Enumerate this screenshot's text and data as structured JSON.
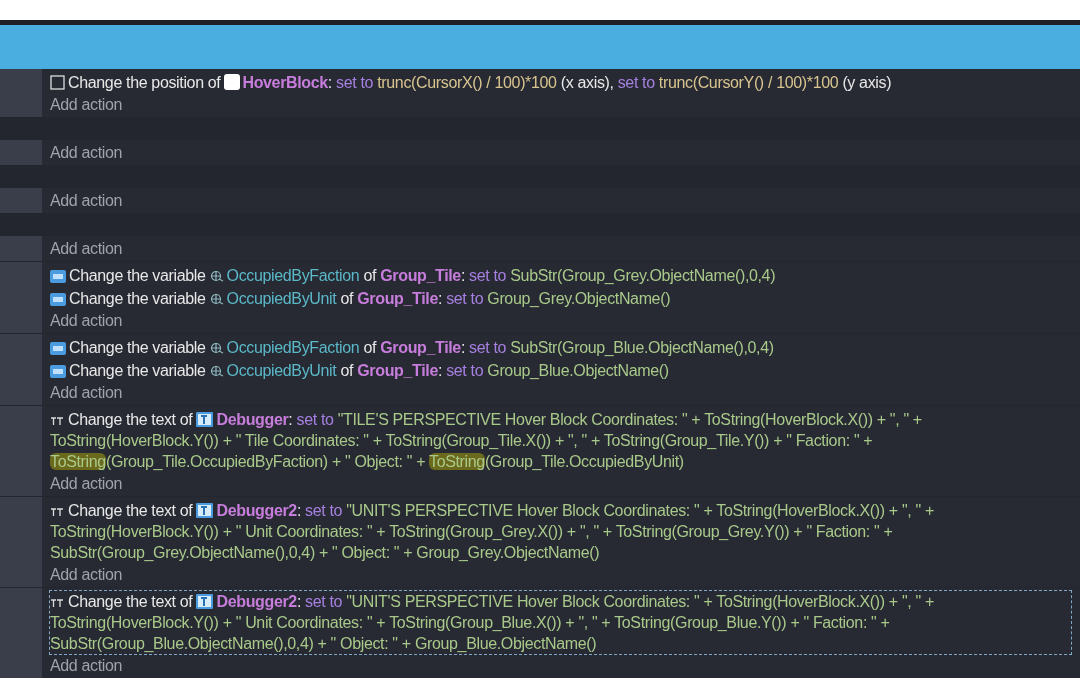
{
  "blocks": [
    {
      "actions": [
        {
          "kind": "position",
          "selected": false,
          "segments": [
            {
              "kind": "text",
              "text": "Change the position of"
            },
            {
              "kind": "object",
              "text": "HoverBlock"
            },
            {
              "kind": "text",
              "text": ": "
            },
            {
              "kind": "keyword",
              "text": "set to"
            },
            {
              "kind": "expression",
              "text": "trunc(CursorX() / 100)*100"
            },
            {
              "kind": "text",
              "text": "(x axis), "
            },
            {
              "kind": "keyword",
              "text": "set to"
            },
            {
              "kind": "expression",
              "text": "trunc(CursorY() / 100)*100"
            },
            {
              "kind": "text",
              "text": "(y axis)"
            }
          ]
        }
      ],
      "add_label": "Add action"
    },
    {
      "add_label": "Add action"
    },
    {
      "add_label": "Add action"
    },
    {
      "add_label": "Add action"
    },
    {
      "actions": [
        {
          "kind": "variable",
          "selected": false,
          "segments": [
            {
              "kind": "text",
              "text": "Change the variable"
            },
            {
              "kind": "variable",
              "text": "OccupiedByFaction"
            },
            {
              "kind": "text",
              "text": "of"
            },
            {
              "kind": "object",
              "text": "Group_Tile"
            },
            {
              "kind": "text",
              "text": ": "
            },
            {
              "kind": "keyword",
              "text": "set to"
            },
            {
              "kind": "string",
              "text": "SubStr(Group_Grey.ObjectName(),0,4)"
            }
          ]
        },
        {
          "kind": "variable",
          "selected": false,
          "segments": [
            {
              "kind": "text",
              "text": "Change the variable"
            },
            {
              "kind": "variable",
              "text": "OccupiedByUnit"
            },
            {
              "kind": "text",
              "text": "of"
            },
            {
              "kind": "object",
              "text": "Group_Tile"
            },
            {
              "kind": "text",
              "text": ": "
            },
            {
              "kind": "keyword",
              "text": "set to"
            },
            {
              "kind": "string",
              "text": "Group_Grey.ObjectName()"
            }
          ]
        }
      ],
      "add_label": "Add action"
    },
    {
      "actions": [
        {
          "kind": "variable",
          "selected": false,
          "segments": [
            {
              "kind": "text",
              "text": "Change the variable"
            },
            {
              "kind": "variable",
              "text": "OccupiedByFaction"
            },
            {
              "kind": "text",
              "text": "of"
            },
            {
              "kind": "object",
              "text": "Group_Tile"
            },
            {
              "kind": "text",
              "text": ": "
            },
            {
              "kind": "keyword",
              "text": "set to"
            },
            {
              "kind": "string",
              "text": "SubStr(Group_Blue.ObjectName(),0,4)"
            }
          ]
        },
        {
          "kind": "variable",
          "selected": false,
          "segments": [
            {
              "kind": "text",
              "text": "Change the variable"
            },
            {
              "kind": "variable",
              "text": "OccupiedByUnit"
            },
            {
              "kind": "text",
              "text": "of"
            },
            {
              "kind": "object",
              "text": "Group_Tile"
            },
            {
              "kind": "text",
              "text": ": "
            },
            {
              "kind": "keyword",
              "text": "set to"
            },
            {
              "kind": "string",
              "text": "Group_Blue.ObjectName()"
            }
          ]
        }
      ],
      "add_label": "Add action"
    },
    {
      "actions": [
        {
          "kind": "text",
          "selected": false,
          "segments": [
            {
              "kind": "text",
              "text": "Change the text of"
            },
            {
              "kind": "object",
              "text": "Debugger"
            },
            {
              "kind": "text",
              "text": ": "
            },
            {
              "kind": "keyword",
              "text": "set to"
            },
            {
              "kind": "string",
              "text": "\"TILE'S PERSPECTIVE Hover Block Coordinates: \" + ToString(HoverBlock.X()) + \", \" + ToString(HoverBlock.Y()) + \" Tile Coordinates: \" + ToString(Group_Tile.X()) + \", \" + ToString(Group_Tile.Y()) + \" Faction: \" +"
            },
            {
              "kind": "marked",
              "text": "ToString"
            },
            {
              "kind": "string",
              "text": "(Group_Tile.OccupiedByFaction) + \" Object: \" +"
            },
            {
              "kind": "marked",
              "text": "ToString"
            },
            {
              "kind": "string",
              "text": "(Group_Tile.OccupiedByUnit)"
            }
          ]
        }
      ],
      "add_label": "Add action"
    },
    {
      "actions": [
        {
          "kind": "text",
          "selected": false,
          "segments": [
            {
              "kind": "text",
              "text": "Change the text of"
            },
            {
              "kind": "object",
              "text": "Debugger2"
            },
            {
              "kind": "text",
              "text": ": "
            },
            {
              "kind": "keyword",
              "text": "set to"
            },
            {
              "kind": "string",
              "text": "\"UNIT'S PERSPECTIVE Hover Block Coordinates: \" + ToString(HoverBlock.X()) + \", \" + ToString(HoverBlock.Y()) + \" Unit Coordinates: \" + ToString(Group_Grey.X()) + \", \" + ToString(Group_Grey.Y()) + \" Faction: \" + SubStr(Group_Grey.ObjectName(),0,4) + \" Object: \" + Group_Grey.ObjectName()"
            }
          ]
        }
      ],
      "add_label": "Add action"
    },
    {
      "actions": [
        {
          "kind": "text",
          "selected": true,
          "segments": [
            {
              "kind": "text",
              "text": "Change the text of"
            },
            {
              "kind": "object",
              "text": "Debugger2"
            },
            {
              "kind": "text",
              "text": ": "
            },
            {
              "kind": "keyword",
              "text": "set to"
            },
            {
              "kind": "string",
              "text": "\"UNIT'S PERSPECTIVE Hover Block Coordinates: \" + ToString(HoverBlock.X()) + \", \" + ToString(HoverBlock.Y()) + \" Unit Coordinates: \" + ToString(Group_Blue.X()) + \", \" + ToString(Group_Blue.Y()) + \" Faction: \" + SubStr(Group_Blue.ObjectName(),0,4) + \" Object: \" + Group_Blue.ObjectName()"
            }
          ]
        }
      ],
      "add_label": "Add action"
    }
  ]
}
